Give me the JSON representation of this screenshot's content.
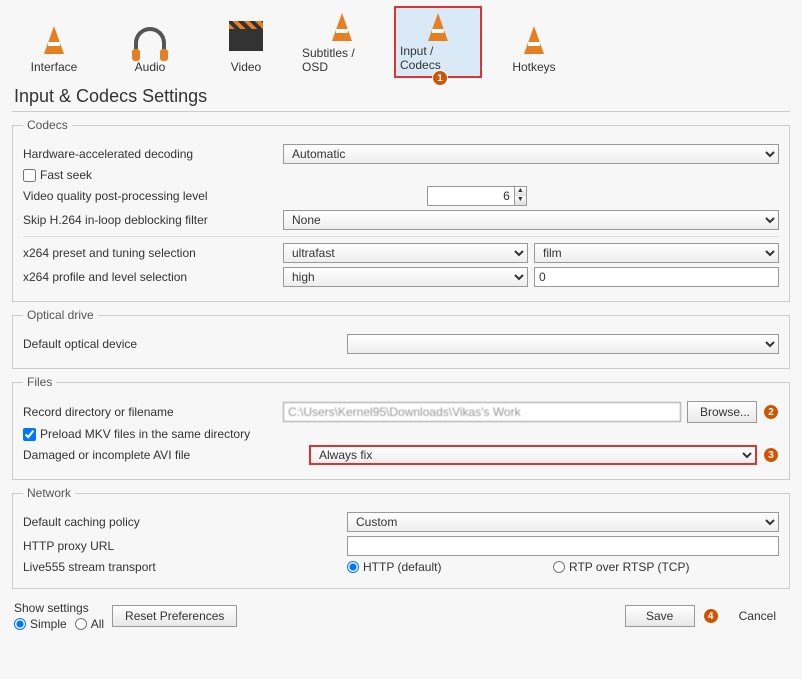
{
  "nav": {
    "interface": "Interface",
    "audio": "Audio",
    "video": "Video",
    "subtitles": "Subtitles / OSD",
    "input_codecs": "Input / Codecs",
    "hotkeys": "Hotkeys"
  },
  "page_title": "Input & Codecs Settings",
  "codecs": {
    "legend": "Codecs",
    "hw_decode_label": "Hardware-accelerated decoding",
    "hw_decode_value": "Automatic",
    "fast_seek_label": "Fast seek",
    "vq_label": "Video quality post-processing level",
    "vq_value": "6",
    "skip_label": "Skip H.264 in-loop deblocking filter",
    "skip_value": "None",
    "x264_preset_label": "x264 preset and tuning selection",
    "x264_preset_value": "ultrafast",
    "x264_tuning_value": "film",
    "x264_profile_label": "x264 profile and level selection",
    "x264_profile_value": "high",
    "x264_level_value": "0"
  },
  "optical": {
    "legend": "Optical drive",
    "device_label": "Default optical device",
    "device_value": ""
  },
  "files": {
    "legend": "Files",
    "record_label": "Record directory or filename",
    "record_value": "C:\\Users\\Kernel95\\Downloads\\Vikas's Work",
    "browse_label": "Browse...",
    "preload_label": "Preload MKV files in the same directory",
    "damaged_label": "Damaged or incomplete AVI file",
    "damaged_value": "Always fix"
  },
  "network": {
    "legend": "Network",
    "caching_label": "Default caching policy",
    "caching_value": "Custom",
    "proxy_label": "HTTP proxy URL",
    "proxy_value": "",
    "live555_label": "Live555 stream transport",
    "opt_http": "HTTP (default)",
    "opt_rtp": "RTP over RTSP (TCP)"
  },
  "footer": {
    "show_settings": "Show settings",
    "simple": "Simple",
    "all": "All",
    "reset": "Reset Preferences",
    "save": "Save",
    "cancel": "Cancel"
  },
  "badges": {
    "b1": "1",
    "b2": "2",
    "b3": "3",
    "b4": "4"
  }
}
